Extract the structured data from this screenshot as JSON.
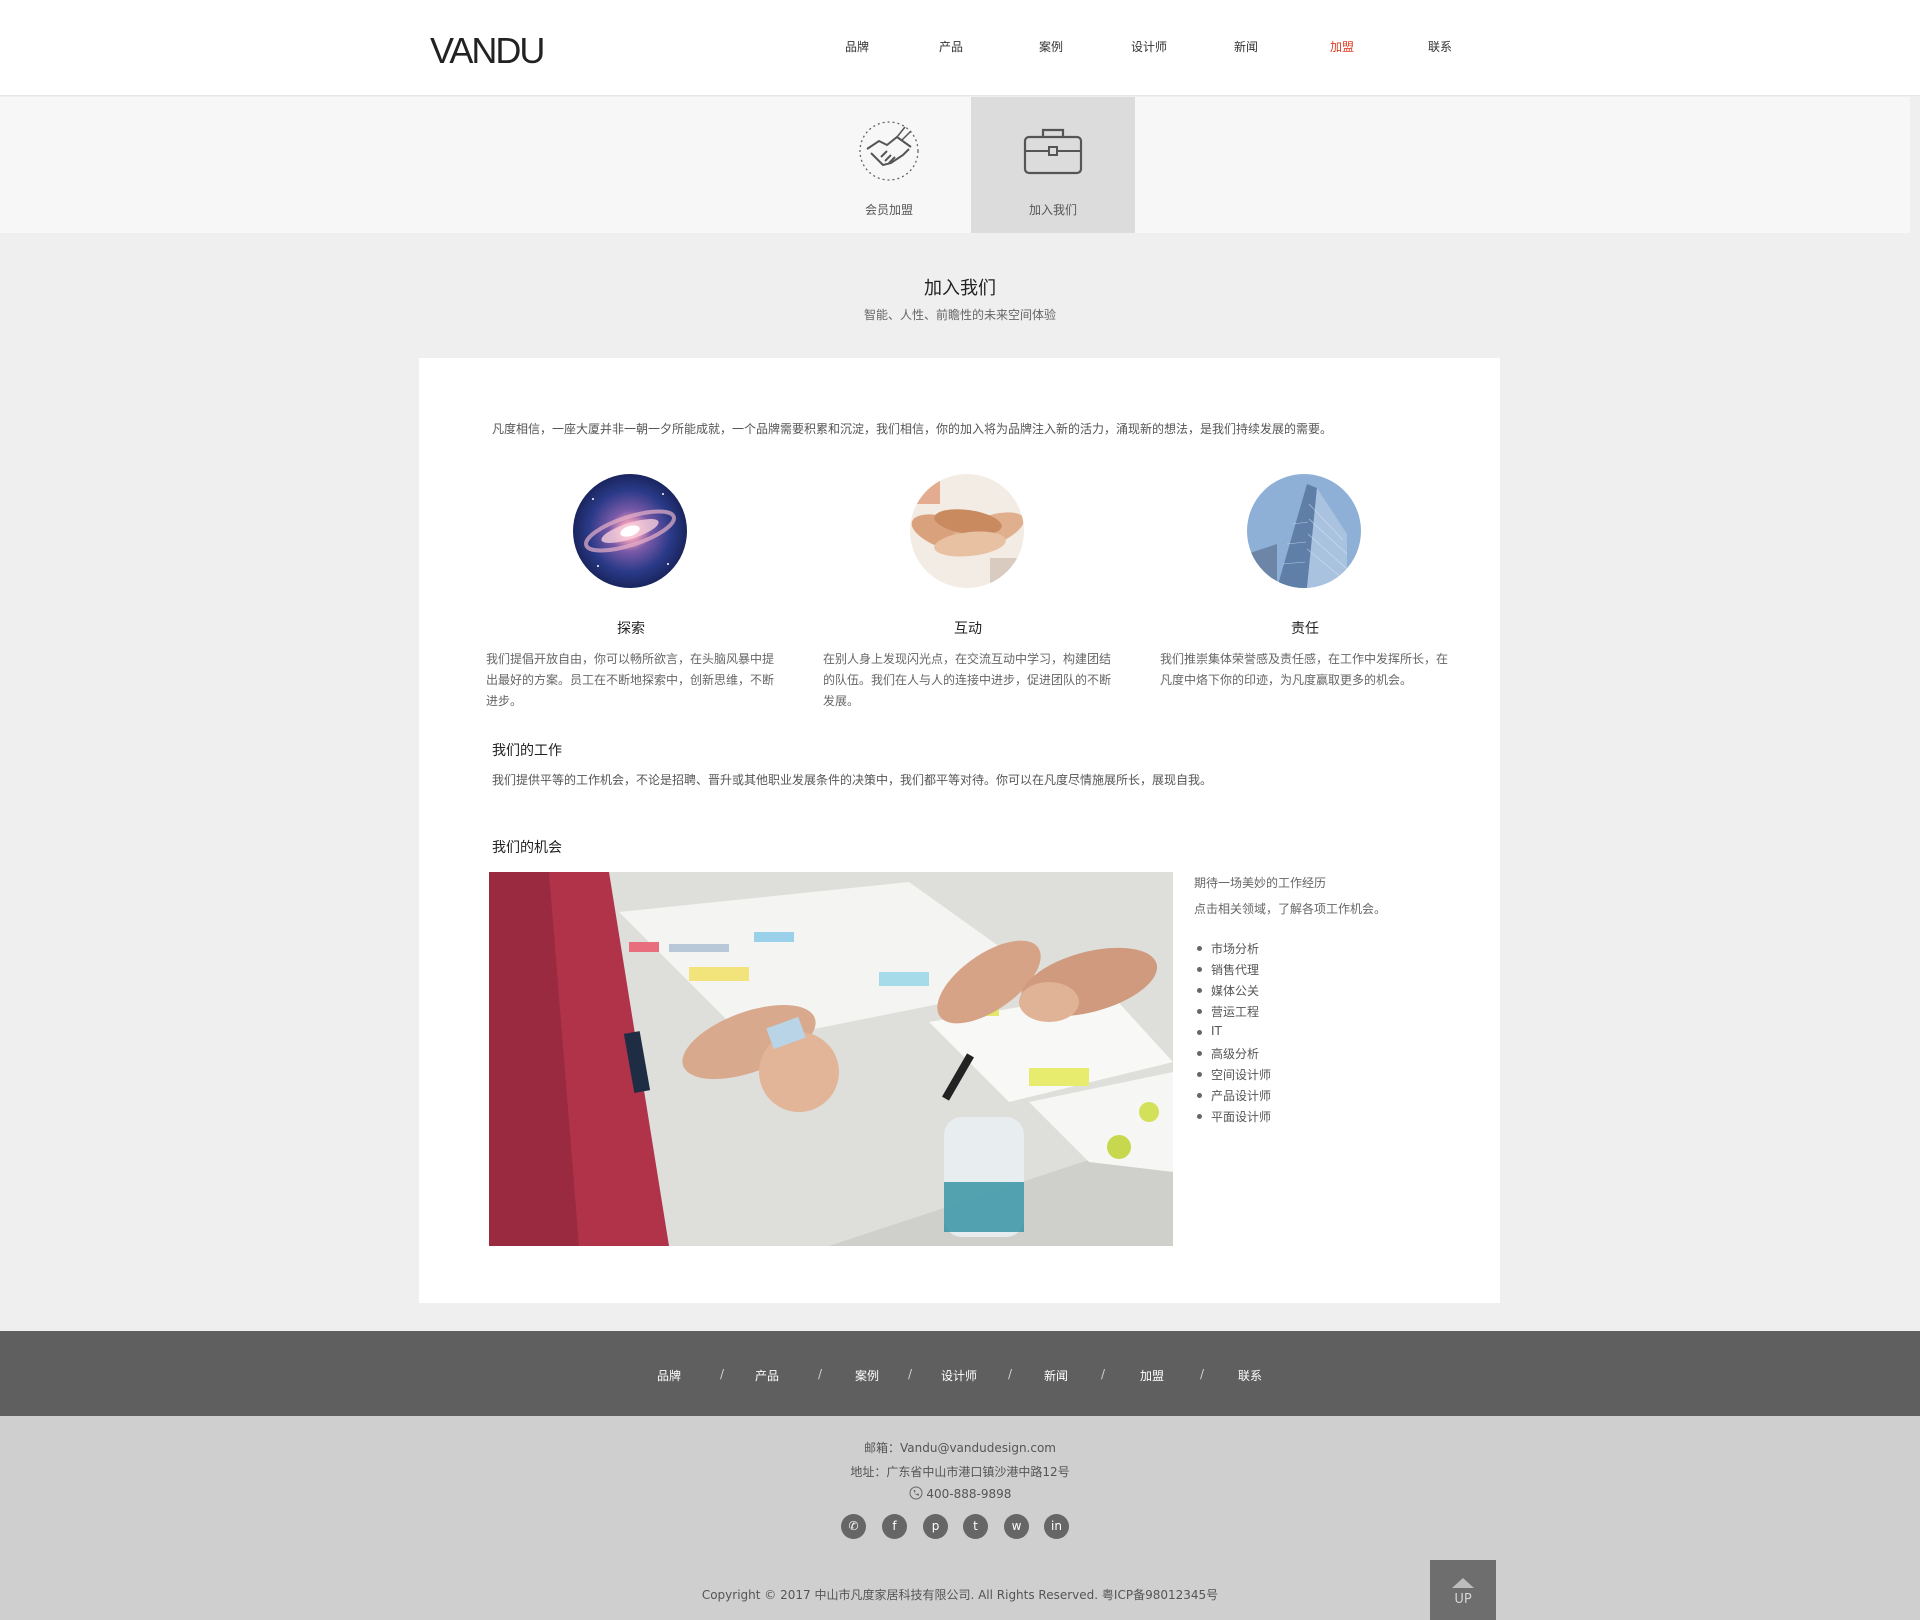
{
  "header": {
    "logo": "VANDU",
    "nav": [
      {
        "label": "品牌"
      },
      {
        "label": "产品"
      },
      {
        "label": "案例"
      },
      {
        "label": "设计师"
      },
      {
        "label": "新闻"
      },
      {
        "label": "加盟",
        "active": true
      },
      {
        "label": "联系"
      }
    ]
  },
  "subtabs": [
    {
      "label": "会员加盟",
      "icon": "handshake-icon"
    },
    {
      "label": "加入我们",
      "icon": "briefcase-icon",
      "selected": true
    }
  ],
  "section": {
    "title": "加入我们",
    "subtitle": "智能、人性、前瞻性的未来空间体验"
  },
  "main": {
    "intro": "凡度相信，一座大厦并非一朝一夕所能成就，一个品牌需要积累和沉淀，我们相信，你的加入将为品牌注入新的活力，涌现新的想法，是我们持续发展的需要。",
    "features": [
      {
        "title": "探索",
        "text": "我们提倡开放自由，你可以畅所欲言，在头脑风暴中提出最好的方案。员工在不断地探索中，创新思维，不断进步。",
        "image": "galaxy"
      },
      {
        "title": "互动",
        "text": "在别人身上发现闪光点，在交流互动中学习，构建团结的队伍。我们在人与人的连接中进步，促进团队的不断发展。",
        "image": "stacked-hands"
      },
      {
        "title": "责任",
        "text": "我们推崇集体荣誉感及责任感，在工作中发挥所长，在凡度中烙下你的印迹，为凡度赢取更多的机会。",
        "image": "glass-skyscraper"
      }
    ],
    "work": {
      "title": "我们的工作",
      "text": "我们提供平等的工作机会，不论是招聘、晋升或其他职业发展条件的决策中，我们都平等对待。你可以在凡度尽情施展所长，展现自我。"
    },
    "opportunity": {
      "title": "我们的机会",
      "line1": "期待一场美妙的工作经历",
      "line2": "点击相关领域，了解各项工作机会。",
      "fields": [
        "市场分析",
        "销售代理",
        "媒体公关",
        "营运工程",
        "IT",
        "高级分析",
        "空间设计师",
        "产品设计师",
        "平面设计师"
      ]
    }
  },
  "footer": {
    "nav": [
      "品牌",
      "产品",
      "案例",
      "设计师",
      "新闻",
      "加盟",
      "联系"
    ],
    "separator": "/",
    "email": "邮箱：Vandu@vandudesign.com",
    "address": "地址：广东省中山市港口镇沙港中路12号",
    "phone": "400-888-9898",
    "socials": [
      "wechat-icon",
      "facebook-icon",
      "pinterest-icon",
      "twitter-icon",
      "weibo-icon",
      "linkedin-icon"
    ],
    "copyright": "Copyright © 2017 中山市凡度家居科技有限公司. All Rights Reserved.     粤ICP备98012345号",
    "up_label": "UP"
  },
  "colors": {
    "accent": "#e03c25",
    "footer_nav_bg": "#5f5f5f",
    "footer_info_bg": "#cfcfcf",
    "page_bg": "#efefef"
  }
}
